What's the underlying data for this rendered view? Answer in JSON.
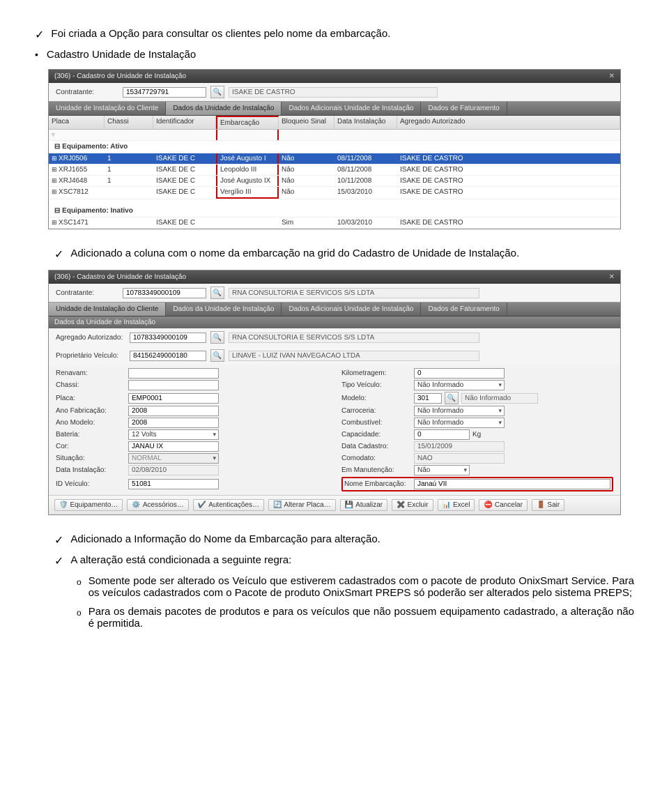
{
  "doc": {
    "line1": "Foi criada a Opção para consultar os clientes pelo nome da embarcação.",
    "line2": "Cadastro Unidade de Instalação",
    "line3": "Adicionado a coluna com o nome da embarcação na grid do Cadastro de Unidade de Instalação.",
    "line4": "Adicionado a Informação do Nome da Embarcação para alteração.",
    "line5": "A alteração está condicionada a seguinte regra:",
    "sub1": "Somente pode ser alterado os Veículo que estiverem cadastrados com o pacote de produto OnixSmart Service. Para os veículos cadastrados com o Pacote de produto OnixSmart PREPS só poderão ser alterados pelo sistema PREPS;",
    "sub2": "Para os demais pacotes de produtos e para os veículos que não possuem equipamento cadastrado, a alteração não é permitida."
  },
  "shot1": {
    "title": "(306) - Cadastro de Unidade de Instalação",
    "contratante_label": "Contratante:",
    "contratante_value": "15347729791",
    "contratante_name": "ISAKE DE CASTRO",
    "tabs": [
      "Unidade de Instalação do Cliente",
      "Dados da Unidade de Instalação",
      "Dados Adicionais Unidade de Instalação",
      "Dados de Faturamento"
    ],
    "active_tab": 1,
    "columns": [
      "Placa",
      "Chassi",
      "Identificador",
      "Embarcação",
      "Bloqueio Sinal",
      "Data Instalação",
      "Agregado Autorizado"
    ],
    "group1": "Equipamento: Ativo",
    "rows_active": [
      {
        "placa": "XRJ0506",
        "chassi": "1",
        "ident": "ISAKE DE C",
        "embarc": "José Augusto I",
        "bloq": "Não",
        "data": "08/11/2008",
        "agreg": "ISAKE DE CASTRO",
        "sel": true
      },
      {
        "placa": "XRJ1655",
        "chassi": "1",
        "ident": "ISAKE DE C",
        "embarc": "Leopoldo III",
        "bloq": "Não",
        "data": "08/11/2008",
        "agreg": "ISAKE DE CASTRO"
      },
      {
        "placa": "XRJ4648",
        "chassi": "1",
        "ident": "ISAKE DE C",
        "embarc": "José Augusto IX",
        "bloq": "Não",
        "data": "10/11/2008",
        "agreg": "ISAKE DE CASTRO"
      },
      {
        "placa": "XSC7812",
        "chassi": "",
        "ident": "ISAKE DE C",
        "embarc": "Vergílio III",
        "bloq": "Não",
        "data": "15/03/2010",
        "agreg": "ISAKE DE CASTRO"
      }
    ],
    "group2": "Equipamento: Inativo",
    "rows_inactive": [
      {
        "placa": "XSC1471",
        "chassi": "",
        "ident": "ISAKE DE C",
        "embarc": "",
        "bloq": "Sim",
        "data": "10/03/2010",
        "agreg": "ISAKE DE CASTRO"
      }
    ]
  },
  "shot2": {
    "title": "(306) - Cadastro de Unidade de Instalação",
    "contratante_label": "Contratante:",
    "contratante_value": "10783349000109",
    "contratante_name": "RNA CONSULTORIA E SERVICOS S/S LDTA",
    "tabs": [
      "Unidade de Instalação do Cliente",
      "Dados da Unidade de Instalação",
      "Dados Adicionais Unidade de Instalação",
      "Dados de Faturamento"
    ],
    "subtitle": "Dados da Unidade de Instalação",
    "fields": {
      "agregado_label": "Agregado Autorizado:",
      "agregado_val": "10783349000109",
      "agregado_name": "RNA CONSULTORIA E SERVICOS S/S LDTA",
      "proprietario_label": "Proprietário Veículo:",
      "proprietario_val": "84156249000180",
      "proprietario_name": "LINAVE - LUIZ IVAN NAVEGACAO LTDA",
      "renavam_label": "Renavam:",
      "renavam_val": "",
      "km_label": "Kilometragem:",
      "km_val": "0",
      "chassi_label": "Chassi:",
      "chassi_val": "",
      "tipoveic_label": "Tipo Veículo:",
      "tipoveic_val": "Não Informado",
      "placa_label": "Placa:",
      "placa_val": "EMP0001",
      "modelo_label": "Modelo:",
      "modelo_val": "301",
      "modelo_name": "Não Informado",
      "anofab_label": "Ano Fabricação:",
      "anofab_val": "2008",
      "carroceria_label": "Carroceria:",
      "carroceria_val": "Não Informado",
      "anomod_label": "Ano Modelo:",
      "anomod_val": "2008",
      "combust_label": "Combustível:",
      "combust_val": "Não Informado",
      "bateria_label": "Bateria:",
      "bateria_val": "12 Volts",
      "capac_label": "Capacidade:",
      "capac_val": "0",
      "capac_unit": "Kg",
      "cor_label": "Cor:",
      "cor_val": "JANAÚ IX",
      "datacad_label": "Data Cadastro:",
      "datacad_val": "15/01/2009",
      "situacao_label": "Situação:",
      "situacao_val": "NORMAL",
      "comodato_label": "Comodato:",
      "comodato_val": "NÃO",
      "datainst_label": "Data Instalação:",
      "datainst_val": "02/08/2010",
      "manut_label": "Em Manutenção:",
      "manut_val": "Não",
      "idveic_label": "ID Veículo:",
      "idveic_val": "51081",
      "nomeembarc_label": "Nome Embarcação:",
      "nomeembarc_val": "Janaú VII"
    },
    "buttons": [
      "Equipamento…",
      "Acessórios…",
      "Autenticações…",
      "Alterar Placa…",
      "Atualizar",
      "Excluir",
      "Excel",
      "Cancelar",
      "Sair"
    ]
  }
}
